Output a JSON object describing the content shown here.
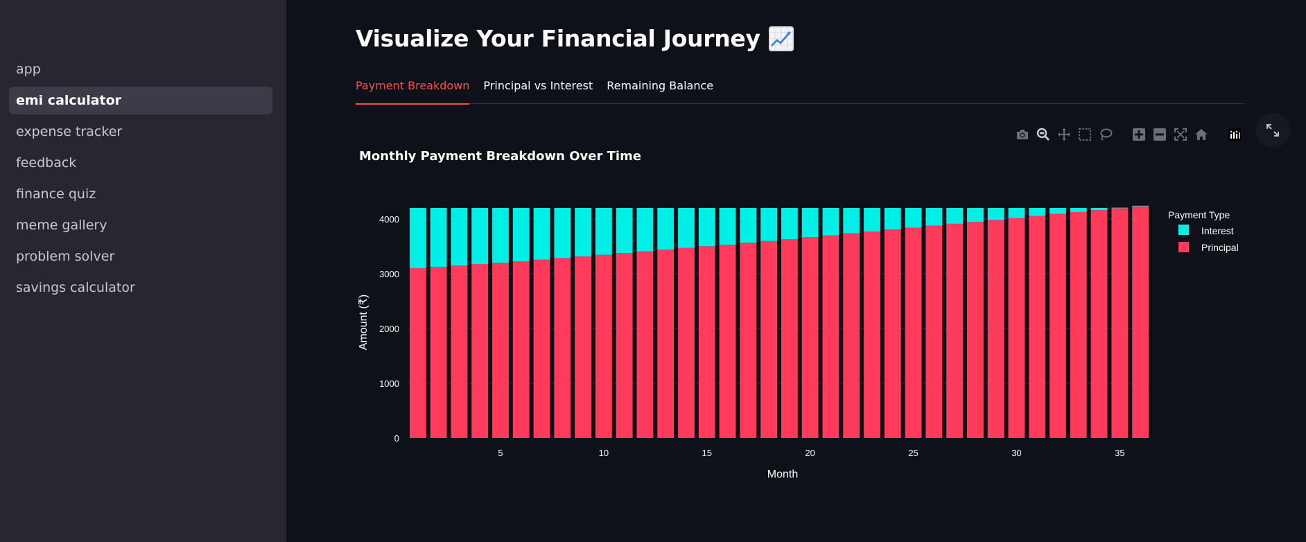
{
  "sidebar": {
    "items": [
      {
        "label": "app",
        "active": false
      },
      {
        "label": "emi calculator",
        "active": true
      },
      {
        "label": "expense tracker",
        "active": false
      },
      {
        "label": "feedback",
        "active": false
      },
      {
        "label": "finance quiz",
        "active": false
      },
      {
        "label": "meme gallery",
        "active": false
      },
      {
        "label": "problem solver",
        "active": false
      },
      {
        "label": "savings calculator",
        "active": false
      }
    ]
  },
  "main": {
    "title": "Visualize Your Financial Journey",
    "title_icon": "chart-increasing-emoji",
    "tabs": [
      {
        "label": "Payment Breakdown",
        "active": true
      },
      {
        "label": "Principal vs Interest",
        "active": false
      },
      {
        "label": "Remaining Balance",
        "active": false
      }
    ]
  },
  "modebar": [
    "camera-icon",
    "zoom-icon",
    "pan-icon",
    "box-select-icon",
    "lasso-icon",
    "zoom-in-icon",
    "zoom-out-icon",
    "autoscale-icon",
    "reset-axes-icon",
    "plotly-logo-icon"
  ],
  "colors": {
    "interest": "#00f0e8",
    "principal": "#ff3a5a",
    "accent": "#ff4b4b",
    "sidebar_bg": "#262730",
    "main_bg": "#0e1117"
  },
  "chart_data": {
    "type": "bar",
    "stacked": true,
    "title": "Monthly Payment Breakdown Over Time",
    "xlabel": "Month",
    "ylabel": "Amount (₹)",
    "legend_title": "Payment Type",
    "legend_position": "top-right",
    "x": [
      1,
      2,
      3,
      4,
      5,
      6,
      7,
      8,
      9,
      10,
      11,
      12,
      13,
      14,
      15,
      16,
      17,
      18,
      19,
      20,
      21,
      22,
      23,
      24,
      25,
      26,
      27,
      28,
      29,
      30,
      31,
      32,
      33,
      34,
      35,
      36
    ],
    "xticks": [
      5,
      10,
      15,
      20,
      25,
      30,
      35
    ],
    "yticks": [
      0,
      1000,
      2000,
      3000,
      4000
    ],
    "ylim": [
      0,
      4200
    ],
    "xlim": [
      0.5,
      36.5
    ],
    "grid": true,
    "series": [
      {
        "name": "Principal",
        "values": [
          3100,
          3125,
          3150,
          3175,
          3200,
          3225,
          3255,
          3285,
          3315,
          3345,
          3375,
          3405,
          3440,
          3470,
          3500,
          3530,
          3565,
          3595,
          3630,
          3665,
          3700,
          3735,
          3770,
          3805,
          3840,
          3875,
          3910,
          3945,
          3980,
          4015,
          4055,
          4090,
          4125,
          4160,
          4195,
          4230
        ]
      },
      {
        "name": "Interest",
        "values": [
          1100,
          1075,
          1050,
          1025,
          1000,
          975,
          945,
          915,
          885,
          855,
          825,
          795,
          760,
          730,
          700,
          670,
          635,
          605,
          570,
          535,
          500,
          465,
          430,
          395,
          360,
          325,
          290,
          255,
          220,
          185,
          145,
          110,
          75,
          40,
          10,
          10
        ]
      }
    ]
  }
}
